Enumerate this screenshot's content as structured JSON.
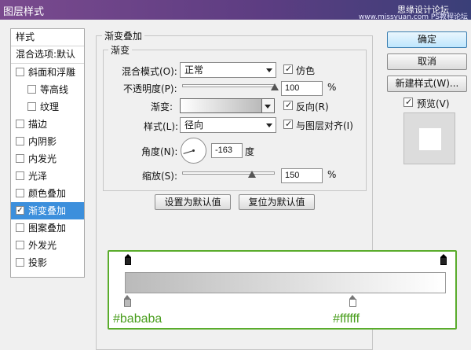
{
  "window": {
    "title": "图层样式",
    "watermark": "思缘设计论坛",
    "watermark2": "www.missyuan.com PS教程论坛"
  },
  "sidebar": {
    "header_styles": "样式",
    "header_blend": "混合选项:默认",
    "items": [
      {
        "label": "斜面和浮雕",
        "checked": false,
        "indent": false
      },
      {
        "label": "等高线",
        "checked": false,
        "indent": true
      },
      {
        "label": "纹理",
        "checked": false,
        "indent": true
      },
      {
        "label": "描边",
        "checked": false,
        "indent": false
      },
      {
        "label": "内阴影",
        "checked": false,
        "indent": false
      },
      {
        "label": "内发光",
        "checked": false,
        "indent": false
      },
      {
        "label": "光泽",
        "checked": false,
        "indent": false
      },
      {
        "label": "颜色叠加",
        "checked": false,
        "indent": false
      },
      {
        "label": "渐变叠加",
        "checked": true,
        "indent": false,
        "active": true
      },
      {
        "label": "图案叠加",
        "checked": false,
        "indent": false
      },
      {
        "label": "外发光",
        "checked": false,
        "indent": false
      },
      {
        "label": "投影",
        "checked": false,
        "indent": false
      }
    ]
  },
  "gradient_overlay": {
    "group_title": "渐变叠加",
    "sub_title": "渐变",
    "blend_mode_label": "混合模式(O):",
    "blend_mode_value": "正常",
    "dither_label": "仿色",
    "dither_checked": true,
    "opacity_label": "不透明度(P):",
    "opacity_value": "100",
    "opacity_unit": "%",
    "opacity_level": 1.0,
    "gradient_label": "渐变:",
    "reverse_label": "反向(R)",
    "reverse_checked": true,
    "style_label": "样式(L):",
    "style_value": "径向",
    "align_label": "与图层对齐(I)",
    "align_checked": true,
    "angle_label": "角度(N):",
    "angle_value": "-163",
    "angle_unit": "度",
    "scale_label": "缩放(S):",
    "scale_value": "150",
    "scale_unit": "%",
    "scale_level": 0.75,
    "set_default_button": "设置为默认值",
    "reset_default_button": "复位为默认值"
  },
  "right_buttons": {
    "ok": "确定",
    "cancel": "取消",
    "new_style": "新建样式(W)...",
    "preview_label": "预览(V)",
    "preview_checked": true
  },
  "gradient_editor": {
    "left_color_label": "#bababa",
    "right_color_label": "#ffffff",
    "left_color": "#bababa",
    "right_color": "#ffffff",
    "right_stop_position": 0.71
  },
  "colors": {
    "annotation_green": "#4a9e1e",
    "selection_blue": "#3c8fdc"
  }
}
